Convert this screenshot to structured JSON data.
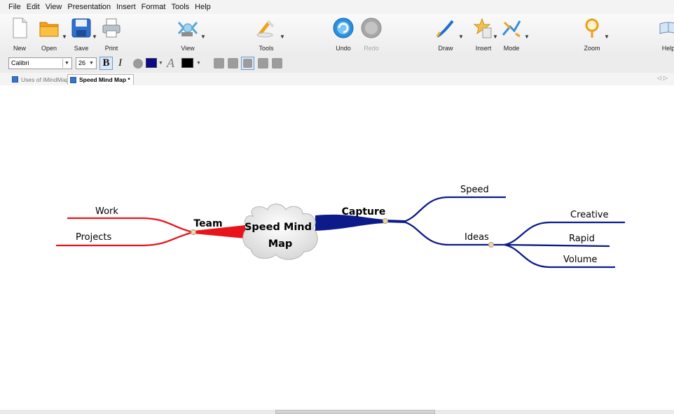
{
  "menu": [
    "File",
    "Edit",
    "View",
    "Presentation",
    "Insert",
    "Format",
    "Tools",
    "Help"
  ],
  "toolbar": {
    "new": "New",
    "open": "Open",
    "save": "Save",
    "print": "Print",
    "view": "View",
    "tools": "Tools",
    "undo": "Undo",
    "redo": "Redo",
    "draw": "Draw",
    "insert": "Insert",
    "mode": "Mode",
    "zoom": "Zoom",
    "help": "Help"
  },
  "format": {
    "font": "Calibri",
    "size": "26",
    "bold": "B",
    "italic": "I",
    "text_style": "A",
    "fill_color": "#0a0a8a",
    "text_color": "#000000"
  },
  "tabs": [
    {
      "label": "Uses of iMindMap *"
    },
    {
      "label": "Speed Mind Map *"
    }
  ],
  "mindmap": {
    "central": {
      "line1": "Speed Mind",
      "line2": "Map"
    },
    "branches": {
      "team": "Team",
      "work": "Work",
      "projects": "Projects",
      "capture": "Capture",
      "speed": "Speed",
      "ideas": "Ideas",
      "creative": "Creative",
      "rapid": "Rapid",
      "volume": "Volume"
    },
    "colors": {
      "red": "#e8141a",
      "blue": "#0c1a8a"
    }
  }
}
